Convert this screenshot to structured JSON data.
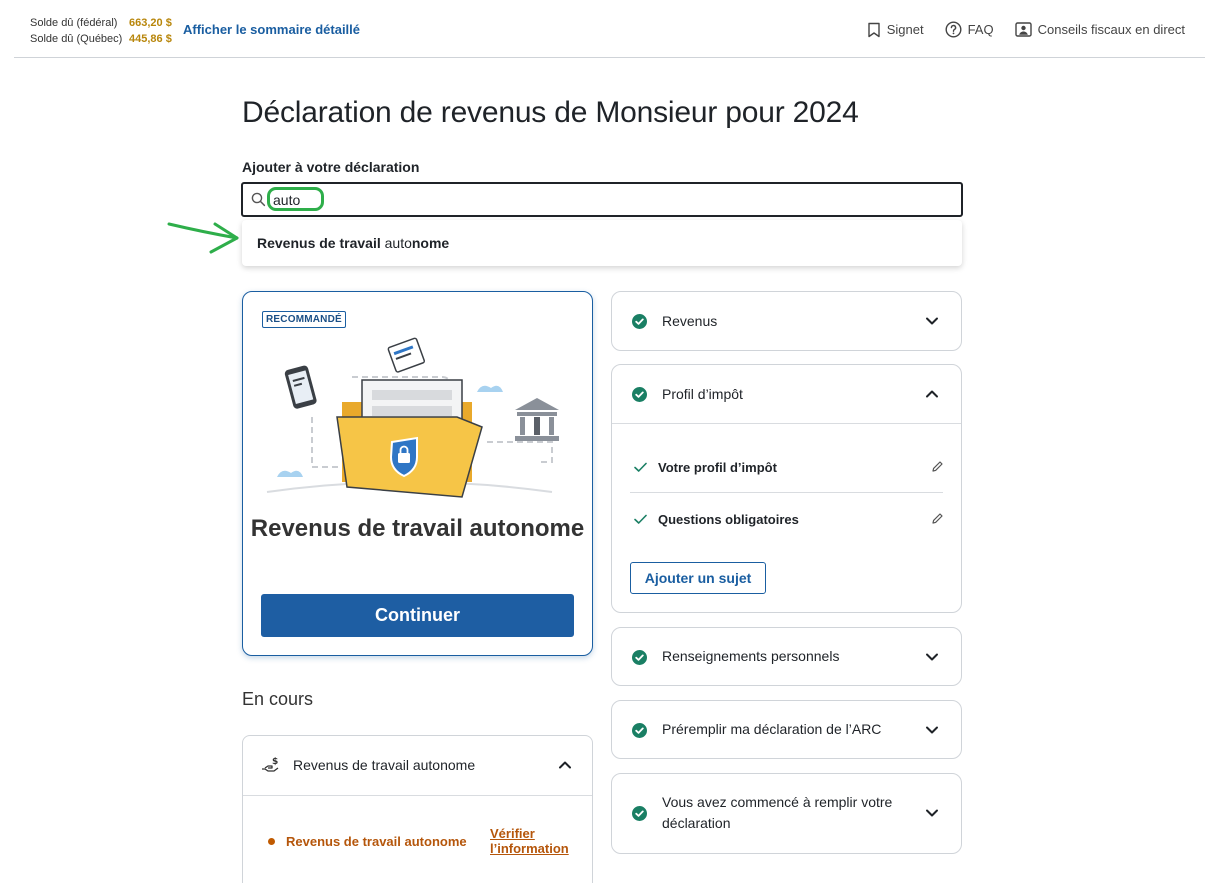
{
  "header": {
    "balances": [
      {
        "label": "Solde dû (fédéral)",
        "amount": "663,20 $"
      },
      {
        "label": "Solde dû (Québec)",
        "amount": "445,86 $"
      }
    ],
    "summary_link": "Afficher le sommaire détaillé",
    "nav": [
      {
        "label": "Signet",
        "icon": "bookmark-icon"
      },
      {
        "label": "FAQ",
        "icon": "help-circle-icon"
      },
      {
        "label": "Conseils fiscaux en direct",
        "icon": "person-portrait-icon"
      }
    ]
  },
  "page": {
    "title": "Déclaration de revenus de Monsieur pour 2024"
  },
  "search": {
    "label": "Ajouter à votre déclaration",
    "value": "auto",
    "suggestion": {
      "bold_start": "Revenus de travail ",
      "match": "auto",
      "bold_end": "nome"
    }
  },
  "recommended": {
    "badge": "RECOMMANDÉ",
    "title": "Revenus de travail autonome",
    "button": "Continuer"
  },
  "in_progress": {
    "title": "En cours",
    "section": "Revenus de travail autonome",
    "item": "Revenus de travail autonome",
    "action": "Vérifier l’information"
  },
  "accordions": [
    {
      "label": "Revenus",
      "expanded": false
    },
    {
      "label": "Profil d’impôt",
      "expanded": true,
      "items": [
        "Votre profil d’impôt",
        "Questions obligatoires"
      ],
      "add_button": "Ajouter un sujet"
    },
    {
      "label": "Renseignements personnels",
      "expanded": false
    },
    {
      "label": "Préremplir ma déclaration de l’ARC",
      "expanded": false
    },
    {
      "label": "Vous avez commencé à remplir votre déclaration",
      "expanded": false
    }
  ],
  "colors": {
    "brand_blue": "#1e5ea3",
    "check_green": "#1a7f64",
    "balance_amber": "#b8860b",
    "progress_orange": "#b5560b",
    "annotation_green": "#2eae4a"
  }
}
